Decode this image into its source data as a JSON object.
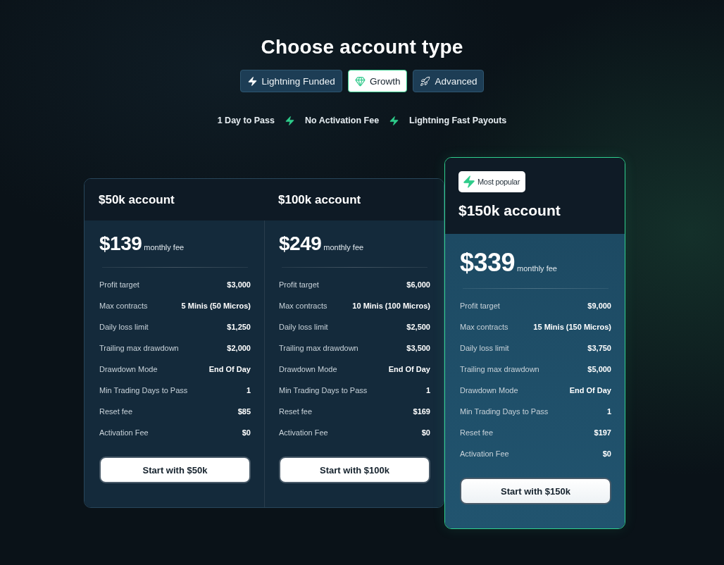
{
  "heading": "Choose account type",
  "tabs": [
    {
      "label": "Lightning Funded",
      "selected": false
    },
    {
      "label": "Growth",
      "selected": true
    },
    {
      "label": "Advanced",
      "selected": false
    }
  ],
  "features": [
    "1 Day to Pass",
    "No Activation Fee",
    "Lightning Fast Payouts"
  ],
  "plans": [
    {
      "title": "$50k account",
      "featured": false,
      "price": "$139",
      "price_note": "monthly fee",
      "details": [
        {
          "label": "Profit target",
          "value": "$3,000"
        },
        {
          "label": "Max contracts",
          "value": "5 Minis (50 Micros)"
        },
        {
          "label": "Daily loss limit",
          "value": "$1,250"
        },
        {
          "label": "Trailing max drawdown",
          "value": "$2,000"
        },
        {
          "label": "Drawdown Mode",
          "value": "End Of Day"
        },
        {
          "label": "Min Trading Days to Pass",
          "value": "1"
        },
        {
          "label": "Reset fee",
          "value": "$85"
        },
        {
          "label": "Activation Fee",
          "value": "$0"
        }
      ],
      "button": "Start with $50k"
    },
    {
      "title": "$100k account",
      "featured": false,
      "price": "$249",
      "price_note": "monthly fee",
      "details": [
        {
          "label": "Profit target",
          "value": "$6,000"
        },
        {
          "label": "Max contracts",
          "value": "10 Minis (100 Micros)"
        },
        {
          "label": "Daily loss limit",
          "value": "$2,500"
        },
        {
          "label": "Trailing max drawdown",
          "value": "$3,500"
        },
        {
          "label": "Drawdown Mode",
          "value": "End Of Day"
        },
        {
          "label": "Min Trading Days to Pass",
          "value": "1"
        },
        {
          "label": "Reset fee",
          "value": "$169"
        },
        {
          "label": "Activation Fee",
          "value": "$0"
        }
      ],
      "button": "Start with $100k"
    },
    {
      "badge": "Most popular",
      "title": "$150k account",
      "featured": true,
      "price": "$339",
      "price_note": "monthly fee",
      "details": [
        {
          "label": "Profit target",
          "value": "$9,000"
        },
        {
          "label": "Max contracts",
          "value": "15 Minis (150 Micros)"
        },
        {
          "label": "Daily loss limit",
          "value": "$3,750"
        },
        {
          "label": "Trailing max drawdown",
          "value": "$5,000"
        },
        {
          "label": "Drawdown Mode",
          "value": "End Of Day"
        },
        {
          "label": "Min Trading Days to Pass",
          "value": "1"
        },
        {
          "label": "Reset fee",
          "value": "$197"
        },
        {
          "label": "Activation Fee",
          "value": "$0"
        }
      ],
      "button": "Start with $150k"
    }
  ]
}
